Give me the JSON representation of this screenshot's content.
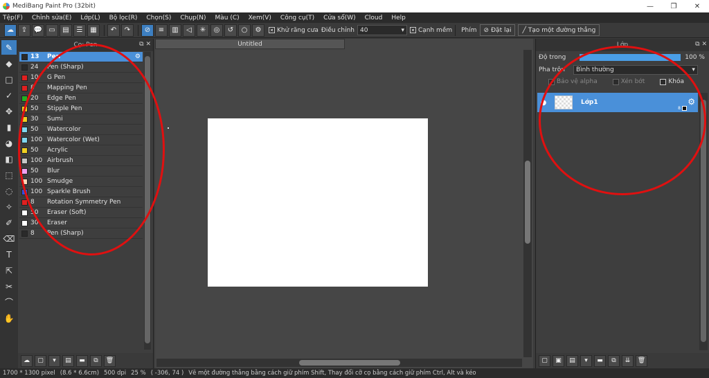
{
  "window": {
    "title": "MediBang Paint Pro (32bit)",
    "controls": {
      "minimize": "—",
      "restore": "❐",
      "close": "✕"
    }
  },
  "menu": [
    "Tệp(F)",
    "Chỉnh sửa(E)",
    "Lớp(L)",
    "Bộ lọc(R)",
    "Chọn(S)",
    "Chụp(N)",
    "Màu (C)",
    "Xem(V)",
    "Công cụ(T)",
    "Cửa sổ(W)",
    "Cloud",
    "Help"
  ],
  "toolbar": {
    "antialias_label": "Khử răng cưa",
    "correction_label": "Điều chỉnh",
    "correction_value": "40",
    "soft_edge_label": "Cạnh mềm",
    "key_label": "Phím",
    "reset_label": "Đặt lại",
    "straight_line_label": "Tạo một đường thẳng"
  },
  "brush_panel": {
    "title": "Cọ: Pen",
    "brushes": [
      {
        "size": "13",
        "name": "Pen",
        "color": "#2a2a2a",
        "selected": true
      },
      {
        "size": "24",
        "name": "Pen (Sharp)",
        "color": "#2a2a2a"
      },
      {
        "size": "10",
        "name": "G Pen",
        "color": "#e02020"
      },
      {
        "size": "8",
        "name": "Mapping Pen",
        "color": "#e02020"
      },
      {
        "size": "20",
        "name": "Edge Pen",
        "color": "#22b022"
      },
      {
        "size": "50",
        "name": "Stipple Pen",
        "color": "#f0d020"
      },
      {
        "size": "30",
        "name": "Sumi",
        "color": "#f0d020"
      },
      {
        "size": "50",
        "name": "Watercolor",
        "color": "#80d8f0"
      },
      {
        "size": "100",
        "name": "Watercolor (Wet)",
        "color": "#80d8f0"
      },
      {
        "size": "50",
        "name": "Acrylic",
        "color": "#f0d020"
      },
      {
        "size": "100",
        "name": "Airbrush",
        "color": "#c8c8c8"
      },
      {
        "size": "50",
        "name": "Blur",
        "color": "#f0a0f0"
      },
      {
        "size": "100",
        "name": "Smudge",
        "color": "#f8d8b8"
      },
      {
        "size": "100",
        "name": "Sparkle Brush",
        "color": "#3050e0"
      },
      {
        "size": "8",
        "name": "Rotation Symmetry Pen",
        "color": "#e02020"
      },
      {
        "size": "50",
        "name": "Eraser (Soft)",
        "color": "#ffffff"
      },
      {
        "size": "30",
        "name": "Eraser",
        "color": "#ffffff"
      },
      {
        "size": "8",
        "name": "Pen (Sharp)",
        "color": "#2a2a2a"
      }
    ]
  },
  "canvas": {
    "tab_title": "Untitled"
  },
  "layer_panel": {
    "title": "Lớp",
    "opacity_label": "Độ trong",
    "opacity_value": "100 %",
    "opacity_fraction": 1.0,
    "blend_label": "Pha trộn",
    "blend_value": "Bình thường",
    "protect_alpha_label": "Bảo vệ alpha",
    "clipping_label": "Xén bớt",
    "lock_label": "Khóa",
    "layers": [
      {
        "name": "Lớp1",
        "bit": "8"
      }
    ]
  },
  "status": {
    "size": "1700 * 1300 pixel",
    "physical": "(8.6 * 6.6cm)",
    "dpi": "500 dpi",
    "zoom": "25 %",
    "cursor": "( -306, 74 )",
    "hint": "Vẽ một đường thẳng bằng cách giữ phím Shift, Thay đổi cỡ cọ bằng cách giữ phím Ctrl, Alt và kéo"
  },
  "colors": {
    "accent": "#4a90d9",
    "annotation": "#e01010"
  }
}
